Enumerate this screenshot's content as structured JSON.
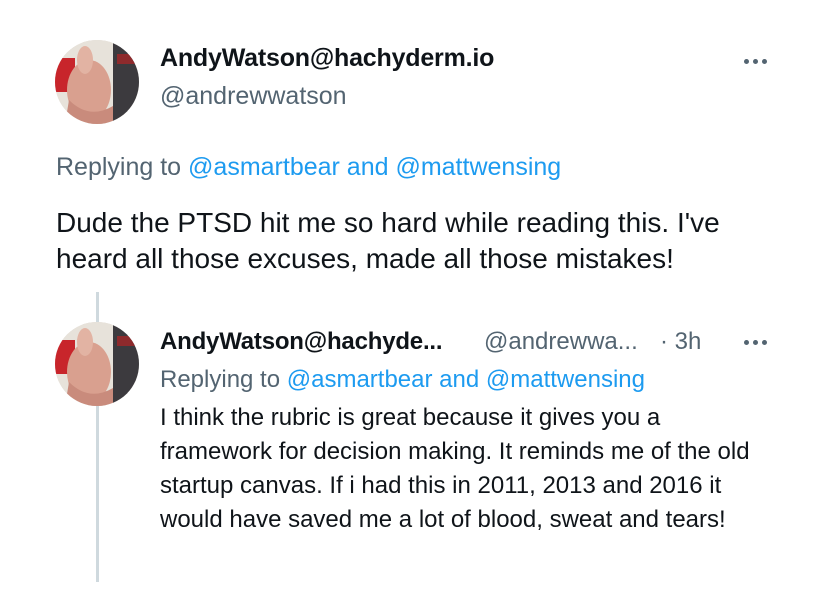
{
  "main_tweet": {
    "author": {
      "display_name": "AndyWatson@hachyderm.io",
      "handle": "@andrewwatson",
      "avatar_icon": "thumbs-up-photo-avatar"
    },
    "replying_prefix": "Replying to",
    "mentions_text": "@asmartbear and @mattwensing",
    "text": "Dude the PTSD hit me so hard while reading this. I've heard all those excuses, made all those mistakes!"
  },
  "reply_tweet": {
    "author": {
      "display_name": "AndyWatson@hachyde...",
      "handle": "@andrewwa...",
      "avatar_icon": "thumbs-up-photo-avatar"
    },
    "time": "· 3h",
    "replying_prefix": "Replying to",
    "mentions_text": "@asmartbear and @mattwensing",
    "text": "I think the rubric is great because it gives you a framework for decision making.  It reminds me of the old startup canvas. If i had this in 2011, 2013 and 2016 it would have saved me a lot of blood, sweat and tears!"
  },
  "colors": {
    "text": "#0f1419",
    "secondary": "#536471",
    "link": "#1d9bf0",
    "thread_line": "#cfd9de"
  },
  "icons": {
    "more": "more-options-icon"
  }
}
